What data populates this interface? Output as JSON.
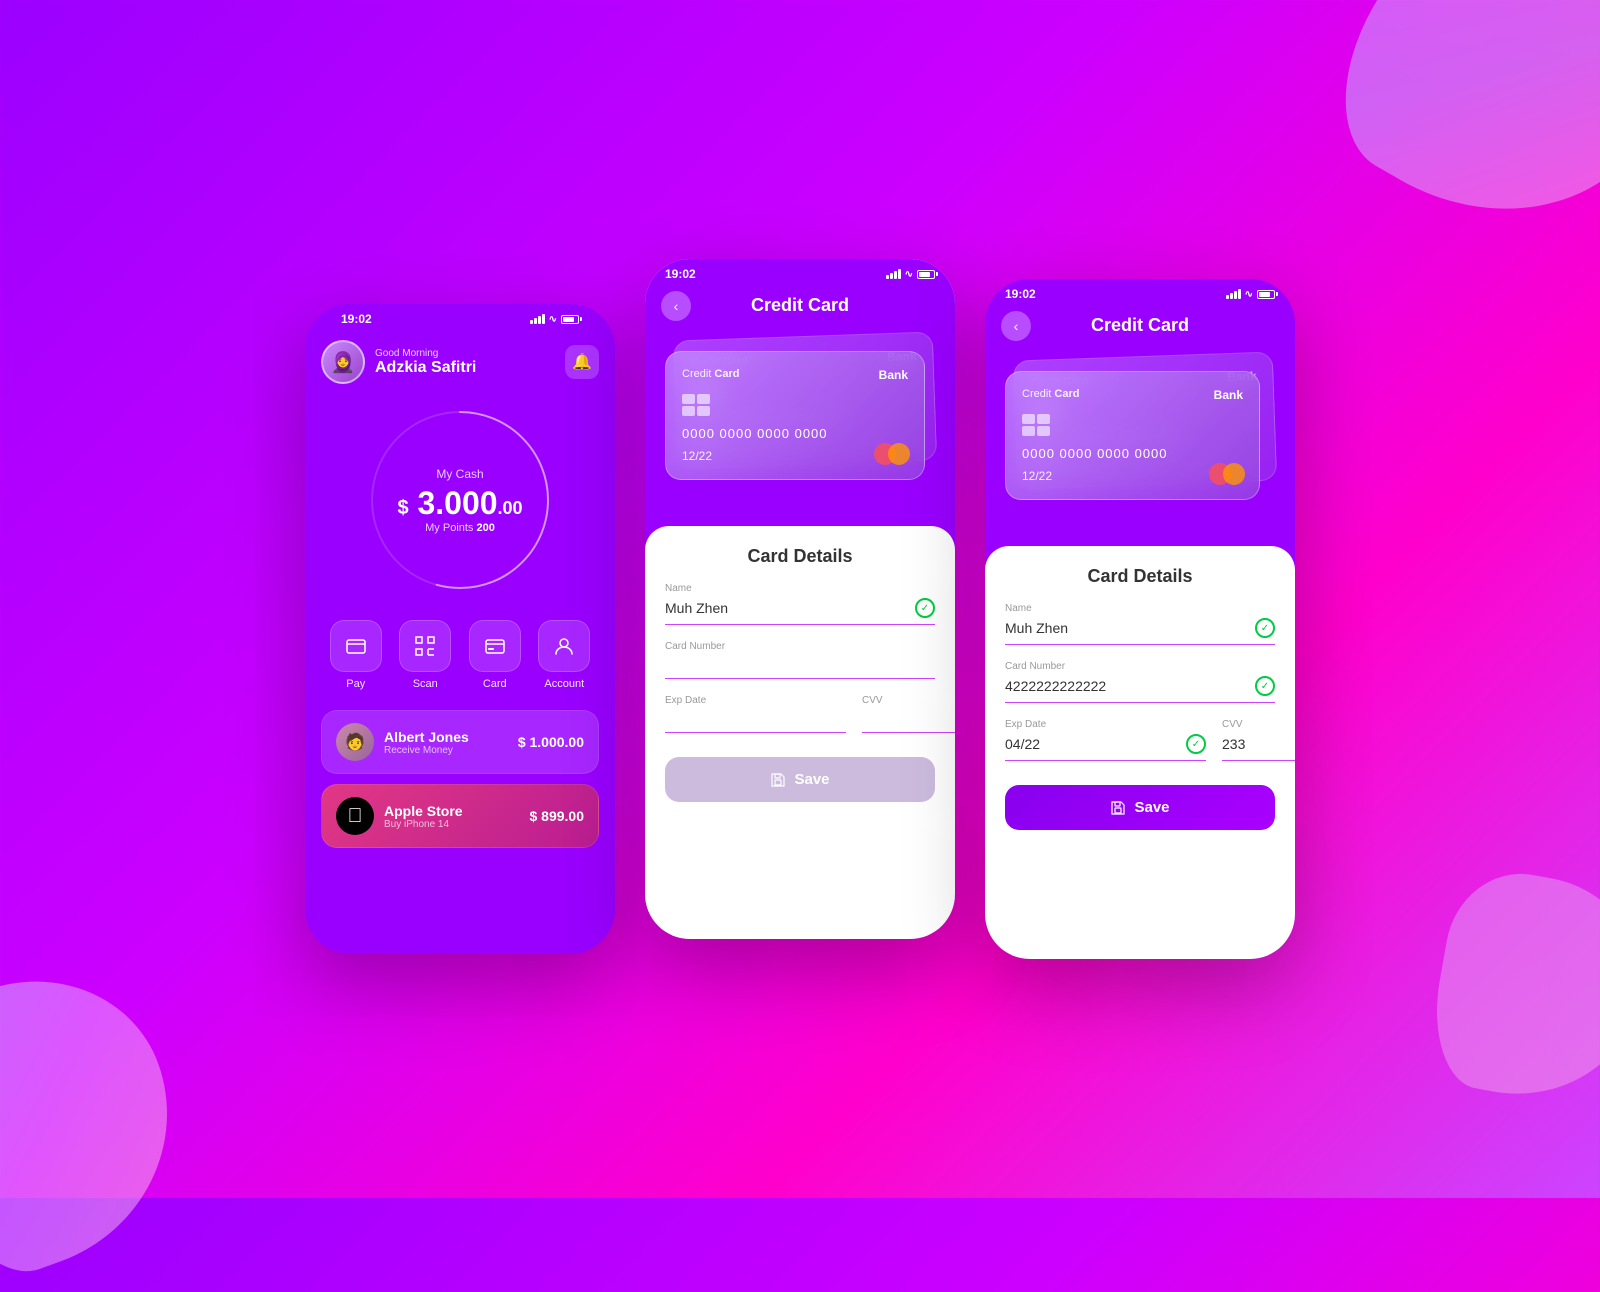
{
  "phone1": {
    "statusbar": {
      "time": "19:02"
    },
    "greeting": "Good Morning",
    "user_name": "Adzkia Safitri",
    "balance_label": "My Cash",
    "balance": "$ 3.000",
    "balance_cents": ".00",
    "points_label": "My Points",
    "points_value": "200",
    "actions": [
      {
        "id": "pay",
        "label": "Pay",
        "icon": "💳"
      },
      {
        "id": "scan",
        "label": "Scan",
        "icon": "⟷"
      },
      {
        "id": "card",
        "label": "Card",
        "icon": "🪪"
      },
      {
        "id": "account",
        "label": "Account",
        "icon": "👤"
      }
    ],
    "transactions": [
      {
        "name": "Albert Jones",
        "sub": "Receive Money",
        "amount": "$ 1.000.00",
        "type": "person"
      },
      {
        "name": "Apple Store",
        "sub": "Buy iPhone 14",
        "amount": "$ 899.00",
        "type": "apple"
      }
    ]
  },
  "phone2": {
    "statusbar": {
      "time": "19:02"
    },
    "title": "Credit Card",
    "card": {
      "label_credit": "Credit",
      "label_card": "Card",
      "label_bank": "Bank",
      "number": "0000 0000 0000 0000",
      "expiry": "12/22"
    },
    "form": {
      "title": "Card Details",
      "name_label": "Name",
      "name_value": "Muh Zhen",
      "card_number_label": "Card Number",
      "card_number_placeholder": "",
      "exp_date_label": "Exp Date",
      "exp_date_placeholder": "",
      "cvv_label": "CVV",
      "cvv_placeholder": "",
      "save_label": "Save"
    }
  },
  "phone3": {
    "statusbar": {
      "time": "19:02"
    },
    "title": "Credit Card",
    "card": {
      "label_credit": "Credit",
      "label_card": "Card",
      "label_bank": "Bank",
      "number": "0000 0000 0000 0000",
      "expiry": "12/22"
    },
    "form": {
      "title": "Card Details",
      "name_label": "Name",
      "name_value": "Muh Zhen",
      "card_number_label": "Card Number",
      "card_number_value": "4222222222222",
      "exp_date_label": "Exp Date",
      "exp_date_value": "04/22",
      "cvv_label": "CVV",
      "cvv_value": "233",
      "save_label": "Save"
    }
  }
}
